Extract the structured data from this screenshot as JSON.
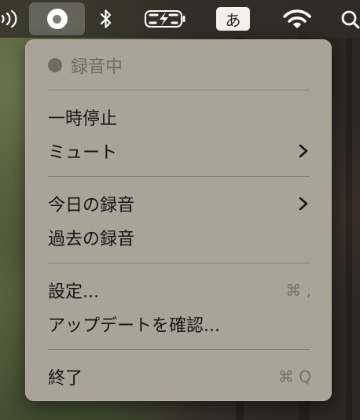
{
  "menubar": {
    "input_source_label": "あ",
    "icons": [
      "control-center-icon",
      "recorder-status-icon",
      "bluetooth-icon",
      "battery-charging-icon",
      "wifi-icon",
      "spotlight-search-icon"
    ]
  },
  "menu": {
    "status_label": "録音中",
    "pause_label": "一時停止",
    "mute_label": "ミュート",
    "today_label": "今日の録音",
    "past_label": "過去の録音",
    "settings_label": "設定...",
    "settings_shortcut": "⌘ ,",
    "update_label": "アップデートを確認...",
    "quit_label": "終了",
    "quit_shortcut": "⌘ Q"
  },
  "colors": {
    "menu_background": "#aaa397",
    "menu_text": "#151515",
    "disabled_text": "#706a61",
    "menubar_background": "#302e26"
  }
}
